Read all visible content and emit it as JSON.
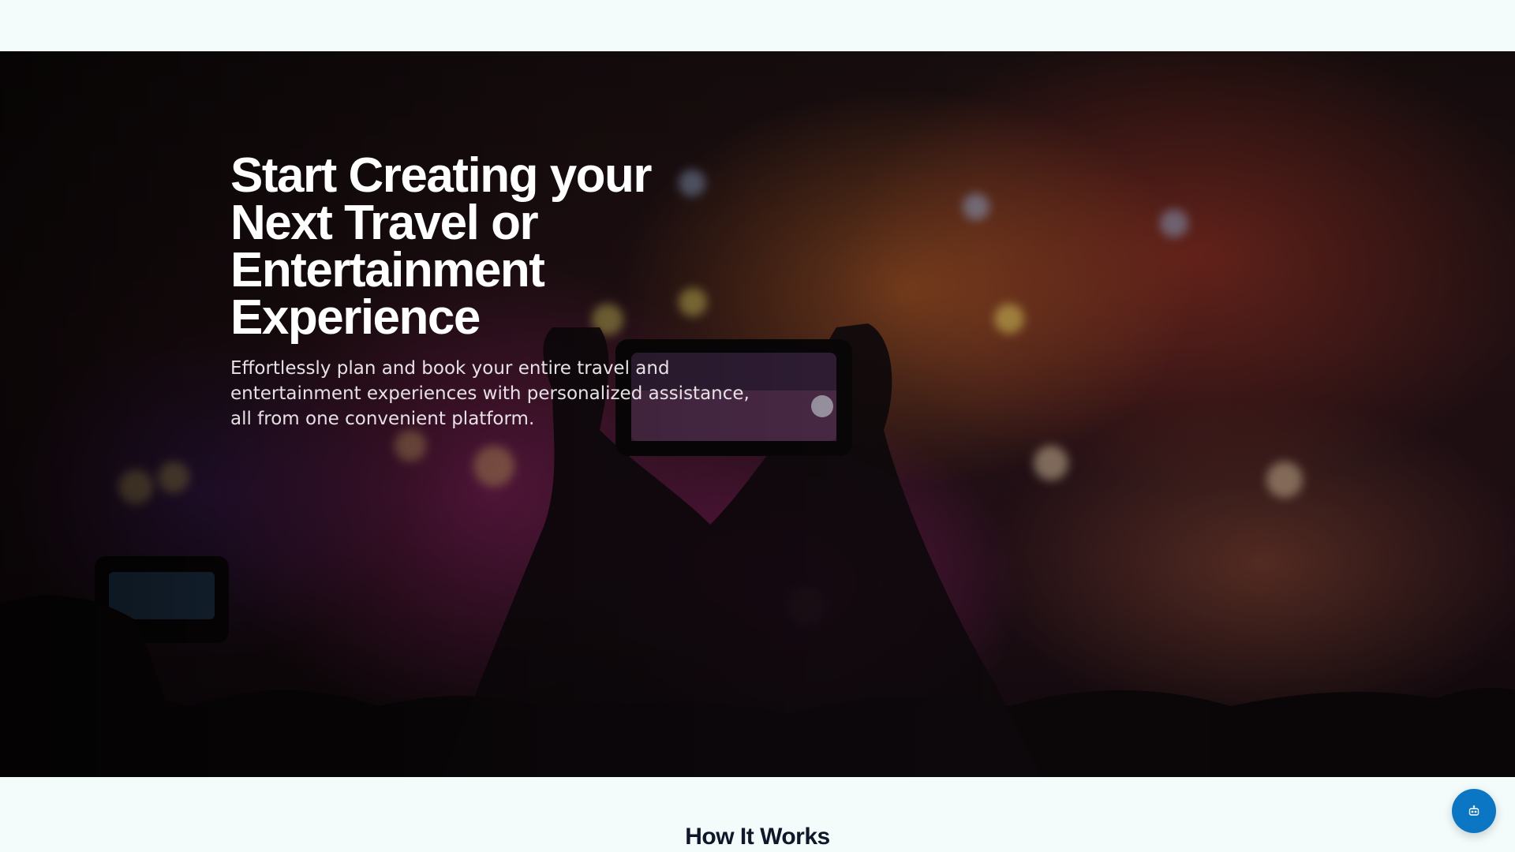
{
  "hero": {
    "title": "Start Creating your Next Travel or Entertainment Experience",
    "subtitle": "Effortlessly plan and book your entire travel and entertainment experiences with personalized assistance, all from one convenient platform.",
    "background_image": "concert-crowd-phone-photo"
  },
  "sections": {
    "how_it_works_title": "How It Works"
  },
  "chat_widget": {
    "icon": "bot-icon",
    "color": "#0b77c4"
  },
  "colors": {
    "page_background": "#f3fbfb",
    "heading_dark": "#0f172a",
    "hero_text": "#ffffff"
  }
}
